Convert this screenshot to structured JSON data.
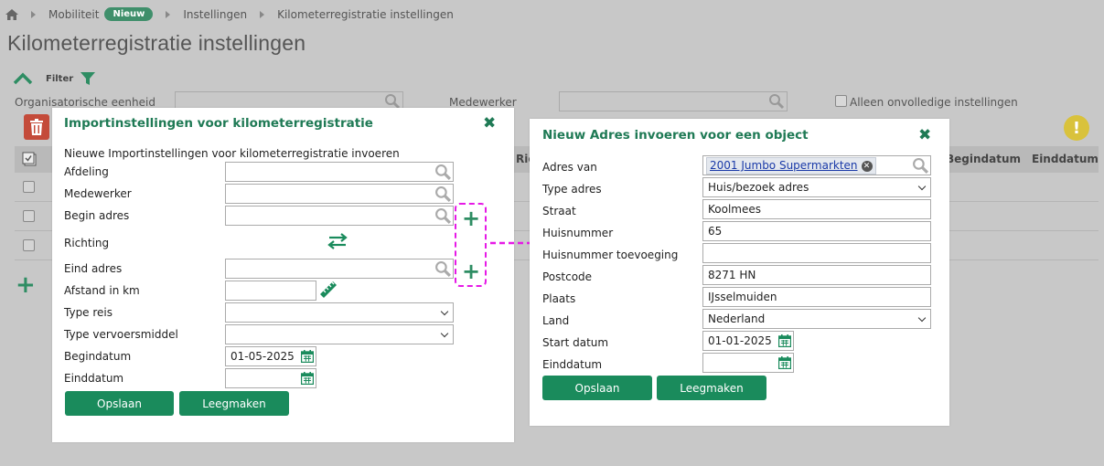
{
  "breadcrumb": {
    "items": [
      "Mobiliteit",
      "Instellingen",
      "Kilometerregistratie instellingen"
    ],
    "badge": "Nieuw"
  },
  "page": {
    "title": "Kilometerregistratie instellingen",
    "filter_label": "Filter",
    "org_unit_label": "Organisatorische eenheid",
    "employee_label": "Medewerker",
    "incomplete_only_label": "Alleen onvolledige instellingen",
    "table_headers": [
      "Ric",
      "Begindatum",
      "Einddatum"
    ],
    "row_count": 3
  },
  "import_dialog": {
    "title": "Importinstellingen voor kilometerregistratie",
    "subtitle": "Nieuwe Importinstellingen voor kilometerregistratie invoeren",
    "labels": {
      "afdeling": "Afdeling",
      "medewerker": "Medewerker",
      "begin_adres": "Begin adres",
      "richting": "Richting",
      "eind_adres": "Eind adres",
      "afstand": "Afstand in km",
      "type_reis": "Type reis",
      "type_vervoer": "Type vervoersmiddel",
      "begindatum": "Begindatum",
      "einddatum": "Einddatum"
    },
    "values": {
      "begindatum": "01-05-2025"
    },
    "save_label": "Opslaan",
    "clear_label": "Leegmaken"
  },
  "address_dialog": {
    "title": "Nieuw Adres invoeren voor een object",
    "labels": {
      "adres_van": "Adres van",
      "type_adres": "Type adres",
      "straat": "Straat",
      "huisnummer": "Huisnummer",
      "toevoeging": "Huisnummer toevoeging",
      "postcode": "Postcode",
      "plaats": "Plaats",
      "land": "Land",
      "start_datum": "Start datum",
      "einddatum": "Einddatum"
    },
    "values": {
      "adres_van": "2001 Jumbo Supermarkten",
      "type_adres": "Huis/bezoek adres",
      "straat": "Koolmees",
      "huisnummer": "65",
      "postcode": "8271 HN",
      "plaats": "IJsselmuiden",
      "land": "Nederland",
      "start_datum": "01-01-2025"
    },
    "save_label": "Opslaan",
    "clear_label": "Leegmaken"
  },
  "colors": {
    "accent_green": "#1a8b5c",
    "title_green": "#1f7a55",
    "annotation_magenta": "#e619e6"
  }
}
